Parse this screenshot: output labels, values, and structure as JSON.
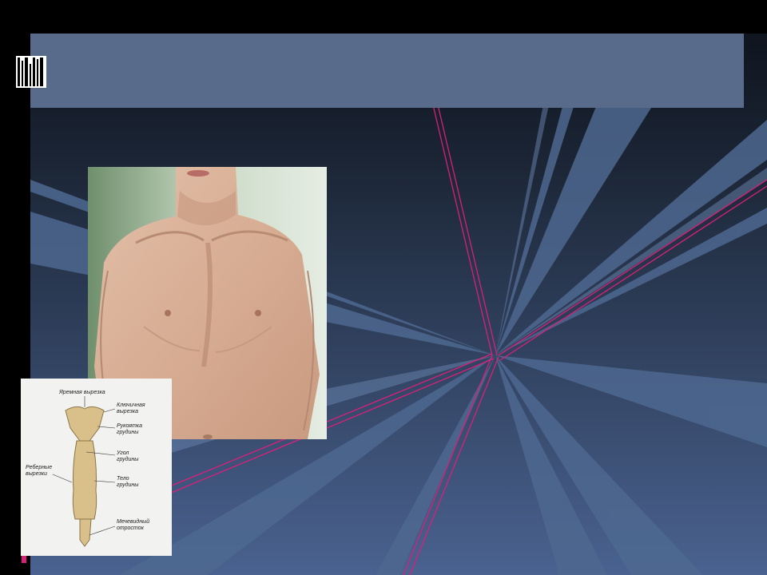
{
  "slide": {
    "title": "",
    "colors": {
      "title_bar": "#586b8a",
      "accent_line": "#d8207a",
      "ray": "#4e6890"
    }
  },
  "chest_photo": {
    "description_icon": "photo-icon"
  },
  "sternum_diagram": {
    "labels": {
      "jugular_notch": "Яремная вырезка",
      "clavicular_notch": "Ключичная\nвырезка",
      "manubrium": "Рукоятка\nгрудины",
      "sternal_angle": "Угол\nгрудины",
      "costal_notches": "Реберные\nвырезки",
      "body": "Тело\nгрудины",
      "xiphoid": "Мечевидный\nотросток"
    }
  }
}
